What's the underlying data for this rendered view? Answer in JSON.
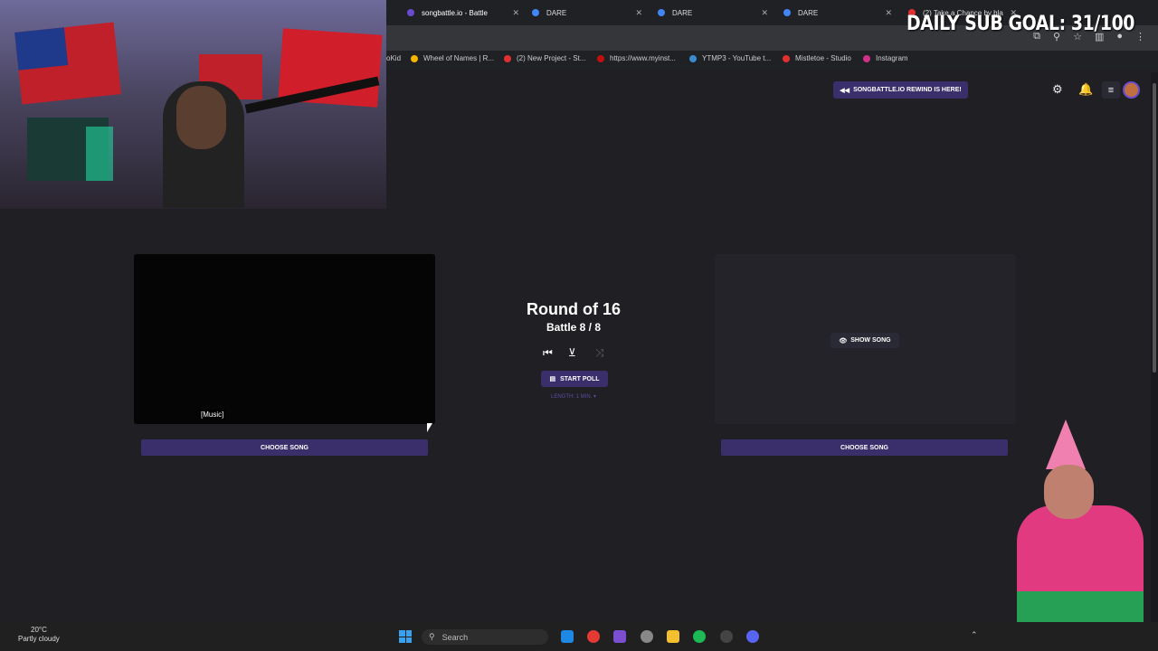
{
  "browser": {
    "tabs": [
      {
        "label": "songbattle.io - Battle",
        "active": true
      },
      {
        "label": "DARE"
      },
      {
        "label": "DARE"
      },
      {
        "label": "DARE"
      },
      {
        "label": "(2) Take a Chance by bla"
      }
    ],
    "bookmarks": [
      "oKid",
      "Wheel of Names | R...",
      "(2) New Project - St...",
      "https://www.myinst...",
      "YTMP3 - YouTube t...",
      "Mistletoe - Studio",
      "Instagram"
    ]
  },
  "overlay": {
    "sub_goal": "DAILY SUB GOAL: 31/100"
  },
  "header": {
    "rewind_label": "SONGBATTLE.IO REWIND IS HERE!"
  },
  "battle": {
    "round": "Round of 16",
    "battle_number": "Battle 8 / 8",
    "start_poll_label": "START POLL",
    "length_label": "LENGTH: 1 MIN. ▾",
    "left_caption": "[Music]",
    "show_song_label": "SHOW SONG",
    "choose_song_left": "CHOOSE SONG",
    "choose_song_right": "CHOOSE SONG"
  },
  "taskbar": {
    "weather_temp": "20°C",
    "weather_desc": "Partly cloudy",
    "search_placeholder": "Search"
  },
  "colors": {
    "accent": "#3a2f6b",
    "background": "#1f1f24"
  }
}
